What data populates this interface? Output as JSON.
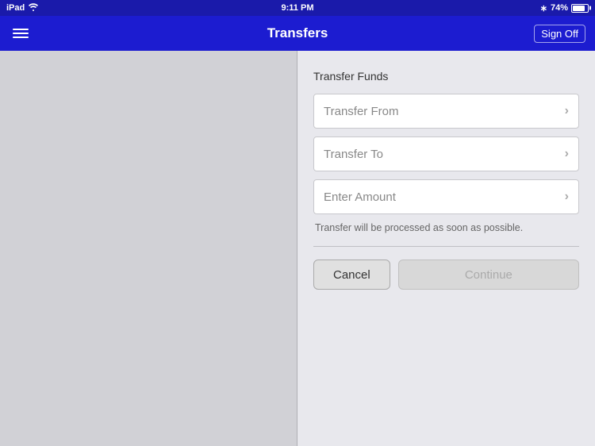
{
  "statusBar": {
    "device": "iPad",
    "time": "9:11 PM",
    "battery_percent": "74%",
    "wifi": true,
    "bluetooth": true
  },
  "navBar": {
    "title": "Transfers",
    "signoff_label": "Sign Off"
  },
  "form": {
    "section_title": "Transfer Funds",
    "transfer_from_placeholder": "Transfer From",
    "transfer_to_placeholder": "Transfer To",
    "enter_amount_placeholder": "Enter Amount",
    "info_text": "Transfer will be processed as soon as possible.",
    "cancel_label": "Cancel",
    "continue_label": "Continue"
  }
}
